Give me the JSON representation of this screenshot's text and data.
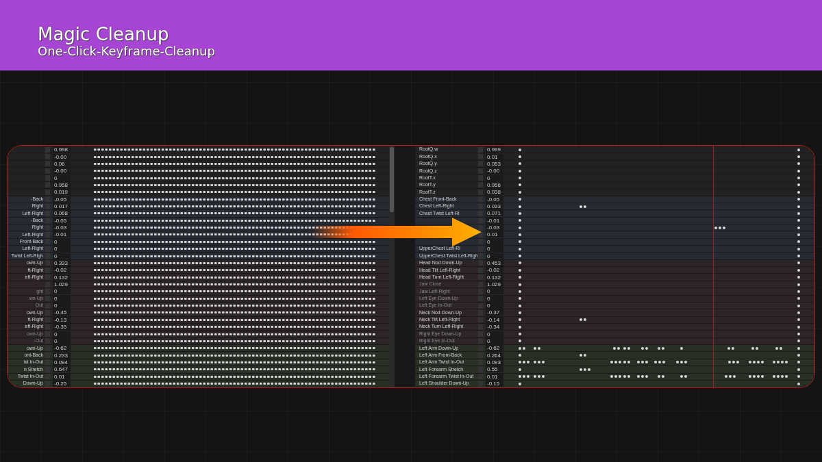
{
  "banner": {
    "title": "Magic Cleanup",
    "subtitle": "One-Click-Keyframe-Cleanup"
  },
  "left_panel": {
    "rows": [
      {
        "value": "0.998",
        "color": "#222222"
      },
      {
        "value": "-0.00",
        "color": "#222222"
      },
      {
        "value": "0.06",
        "color": "#222222"
      },
      {
        "value": "-0.00",
        "color": "#222222"
      },
      {
        "value": "0",
        "color": "#222222"
      },
      {
        "value": "0.958",
        "color": "#222222"
      },
      {
        "value": "0.019",
        "color": "#222222"
      },
      {
        "name": "-Back",
        "value": "-0.05",
        "dim": false,
        "color": "#262b33"
      },
      {
        "name": "Right",
        "value": "0.017",
        "dim": false,
        "color": "#262b33"
      },
      {
        "name": "Left-Right",
        "value": "0.068",
        "dim": false,
        "color": "#262b33"
      },
      {
        "name": "-Back",
        "value": "-0.05",
        "dim": false,
        "color": "#262b33"
      },
      {
        "name": "Right",
        "value": "-0.03",
        "dim": false,
        "color": "#262b33"
      },
      {
        "name": "Left-Right",
        "value": "-0.01",
        "dim": false,
        "color": "#262b33"
      },
      {
        "name": "Front-Back",
        "value": "0",
        "dim": false,
        "color": "#262b33"
      },
      {
        "name": "Left-Right",
        "value": "0",
        "dim": false,
        "color": "#262b33"
      },
      {
        "name": "Twist Left-Righ",
        "value": "0",
        "dim": false,
        "color": "#262b33"
      },
      {
        "name": "own-Up",
        "value": "0.333",
        "dim": false,
        "color": "#2d2427"
      },
      {
        "name": "ft-Right",
        "value": "-0.02",
        "dim": false,
        "color": "#2d2427"
      },
      {
        "name": "eft-Right",
        "value": "0.132",
        "dim": false,
        "color": "#2d2427"
      },
      {
        "value": "1.029",
        "color": "#2d2427"
      },
      {
        "name": "ght",
        "value": "0",
        "dim": true,
        "color": "#2d2427"
      },
      {
        "name": "wn-Up",
        "value": "0",
        "dim": true,
        "color": "#2d2427"
      },
      {
        "name": "Out",
        "value": "0",
        "dim": true,
        "color": "#2d2427"
      },
      {
        "name": "own-Up",
        "value": "-0.45",
        "dim": false,
        "color": "#2d2427"
      },
      {
        "name": "ft-Right",
        "value": "-0.13",
        "dim": false,
        "color": "#2d2427"
      },
      {
        "name": "eft-Right",
        "value": "-0.35",
        "dim": false,
        "color": "#2d2427"
      },
      {
        "name": "own-Up",
        "value": "0",
        "dim": true,
        "color": "#2d2427"
      },
      {
        "name": "-Out",
        "value": "0",
        "dim": true,
        "color": "#2d2427"
      },
      {
        "name": "own-Up",
        "value": "-0.62",
        "dim": false,
        "color": "#283026"
      },
      {
        "name": "ont-Back",
        "value": "0.233",
        "dim": false,
        "color": "#283026"
      },
      {
        "name": "ist In-Out",
        "value": "0.094",
        "dim": false,
        "color": "#283026"
      },
      {
        "name": "n Stretch",
        "value": "0.647",
        "dim": false,
        "color": "#283026"
      },
      {
        "name": "Twist In-Out",
        "value": "0.01",
        "dim": false,
        "color": "#283026"
      },
      {
        "name": "Down-Up",
        "value": "-0.25",
        "dim": false,
        "color": "#283026"
      }
    ]
  },
  "right_panel": {
    "rows": [
      {
        "name": "RootQ.w",
        "value": "0.999",
        "dim": false,
        "color": "#222222",
        "kind": "ends"
      },
      {
        "name": "RootQ.x",
        "value": "0.01",
        "dim": false,
        "color": "#222222",
        "kind": "ends"
      },
      {
        "name": "RootQ.y",
        "value": "0.053",
        "dim": false,
        "color": "#222222",
        "kind": "ends"
      },
      {
        "name": "RootQ.z",
        "value": "-0.00",
        "dim": false,
        "color": "#222222",
        "kind": "ends"
      },
      {
        "name": "RootT.x",
        "value": "0",
        "dim": false,
        "color": "#222222",
        "kind": "ends"
      },
      {
        "name": "RootT.y",
        "value": "0.956",
        "dim": false,
        "color": "#222222",
        "kind": "ends"
      },
      {
        "name": "RootT.z",
        "value": "0.038",
        "dim": false,
        "color": "#222222",
        "kind": "ends"
      },
      {
        "name": "Chest Front-Back",
        "value": "-0.05",
        "dim": false,
        "color": "#262b33",
        "kind": "ends"
      },
      {
        "name": "Chest Left-Right",
        "value": "0.033",
        "dim": false,
        "color": "#262b33",
        "kind": "pair"
      },
      {
        "name": "Chest Twist Left-Ri",
        "value": "0.071",
        "dim": false,
        "color": "#262b33",
        "kind": "ends"
      },
      {
        "value": "-0.01",
        "color": "#262b33",
        "kind": "ends"
      },
      {
        "value": "-0.03",
        "color": "#262b33",
        "kind": "late-triple"
      },
      {
        "value": "0.01",
        "color": "#262b33",
        "kind": "ends"
      },
      {
        "value": "0",
        "color": "#262b33",
        "kind": "ends"
      },
      {
        "name": "UpperChest Left-Ri",
        "value": "0",
        "dim": false,
        "color": "#262b33",
        "kind": "ends"
      },
      {
        "name": "UpperChest Twist Left-Righ",
        "value": "0",
        "dim": false,
        "color": "#262b33",
        "kind": "ends"
      },
      {
        "name": "Head Nod Down-Up",
        "value": "0.453",
        "dim": false,
        "color": "#2d2427",
        "kind": "ends"
      },
      {
        "name": "Head Tilt Left-Right",
        "value": "-0.02",
        "dim": false,
        "color": "#2d2427",
        "kind": "ends"
      },
      {
        "name": "Head Turn Left-Right",
        "value": "0.132",
        "dim": false,
        "color": "#2d2427",
        "kind": "ends"
      },
      {
        "name": "Jaw Close",
        "value": "1.029",
        "dim": true,
        "color": "#2d2427",
        "kind": "ends"
      },
      {
        "name": "Jaw Left-Right",
        "value": "0",
        "dim": true,
        "color": "#2d2427",
        "kind": "ends"
      },
      {
        "name": "Left Eye Down-Up",
        "value": "0",
        "dim": true,
        "color": "#2d2427",
        "kind": "ends"
      },
      {
        "name": "Left Eye In-Out",
        "value": "0",
        "dim": true,
        "color": "#2d2427",
        "kind": "ends"
      },
      {
        "name": "Neck Nod Down-Up",
        "value": "-0.37",
        "dim": false,
        "color": "#2d2427",
        "kind": "ends"
      },
      {
        "name": "Neck Tilt Left-Right",
        "value": "-0.14",
        "dim": false,
        "color": "#2d2427",
        "kind": "pair"
      },
      {
        "name": "Neck Turn Left-Right",
        "value": "-0.34",
        "dim": false,
        "color": "#2d2427",
        "kind": "ends"
      },
      {
        "name": "Right Eye Down-Up",
        "value": "0",
        "dim": true,
        "color": "#2d2427",
        "kind": "ends"
      },
      {
        "name": "Right Eye In-Out",
        "value": "0",
        "dim": true,
        "color": "#2d2427",
        "kind": "ends"
      },
      {
        "name": "Left Arm Down-Up",
        "value": "-0.62",
        "dim": false,
        "color": "#283026",
        "kind": "arm-pairs"
      },
      {
        "name": "Left Arm Front-Back",
        "value": "0.264",
        "dim": false,
        "color": "#283026",
        "kind": "pair"
      },
      {
        "name": "Left Arm Twist In-Out",
        "value": "0.093",
        "dim": false,
        "color": "#283026",
        "kind": "arm-triples"
      },
      {
        "name": "Left Forearm Stretch",
        "value": "0.55",
        "dim": false,
        "color": "#283026",
        "kind": "triple"
      },
      {
        "name": "Left Forearm Twist In-Out",
        "value": "0.01",
        "dim": false,
        "color": "#283026",
        "kind": "arm-mixed"
      },
      {
        "name": "Left Shoulder Down-Up",
        "value": "-0.15",
        "dim": false,
        "color": "#283026",
        "kind": "ends"
      }
    ]
  }
}
